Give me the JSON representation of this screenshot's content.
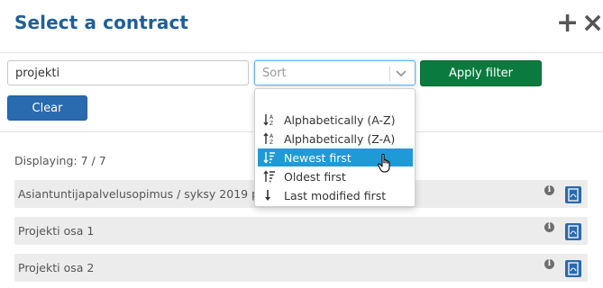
{
  "dialog": {
    "title": "Select a contract"
  },
  "filters": {
    "search_value": "projekti",
    "sort_placeholder": "Sort",
    "apply_label": "Apply filter",
    "clear_label": "Clear"
  },
  "sort_options": [
    {
      "label": "Alphabetically (A-Z)",
      "icon": "sort-alpha-asc-icon"
    },
    {
      "label": "Alphabetically (Z-A)",
      "icon": "sort-alpha-desc-icon"
    },
    {
      "label": "Newest first",
      "icon": "sort-newest-icon",
      "highlighted": true
    },
    {
      "label": "Oldest first",
      "icon": "sort-oldest-icon"
    },
    {
      "label": "Last modified first",
      "icon": "arrow-down-icon"
    }
  ],
  "list": {
    "displaying": "Displaying: 7 / 7",
    "items": [
      {
        "name": "Asiantuntijapalvelusopimus / syksy 2019 projekti"
      },
      {
        "name": "Projekti osa 1"
      },
      {
        "name": "Projekti osa 2"
      }
    ]
  },
  "colors": {
    "title": "#1f5f97",
    "apply": "#0b7a3e",
    "clear": "#2a6aaf",
    "highlight": "#1e9bd7",
    "row": "#ececec"
  }
}
